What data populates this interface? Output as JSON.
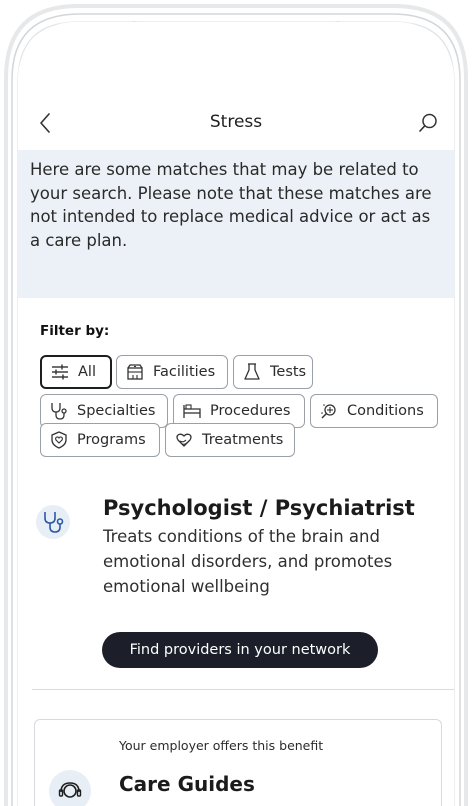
{
  "header": {
    "title": "Stress",
    "back_icon": "chevron-left-icon",
    "search_icon": "search-icon"
  },
  "disclaimer": {
    "text": "Here are some matches that may be related to your search.  Please note that these matches are not intended to replace medical advice or act as a care plan."
  },
  "filters": {
    "label": "Filter by:",
    "selected": "All",
    "chips": [
      {
        "label": "All",
        "icon": "sliders-icon"
      },
      {
        "label": "Facilities",
        "icon": "facility-icon"
      },
      {
        "label": "Tests",
        "icon": "flask-icon"
      },
      {
        "label": "Specialties",
        "icon": "stethoscope-icon"
      },
      {
        "label": "Procedures",
        "icon": "bed-icon"
      },
      {
        "label": "Conditions",
        "icon": "magnifier-sparkle-icon"
      },
      {
        "label": "Programs",
        "icon": "shield-heart-icon"
      },
      {
        "label": "Treatments",
        "icon": "heart-hands-icon"
      }
    ]
  },
  "result": {
    "icon": "stethoscope-icon",
    "title": "Psychologist / Psychiatrist",
    "description": "Treats conditions of the brain and emotional disorders, and promotes emotional wellbeing",
    "button_label": "Find providers in your network"
  },
  "benefit": {
    "note": "Your employer offers this benefit",
    "title": "Care Guides",
    "icon": "care-guide-icon"
  },
  "colors": {
    "banner_bg": "#ecf1f7",
    "button_bg": "#1c1f2a",
    "icon_blue": "#2a5aa8",
    "icon_bubble": "#e8eef6"
  }
}
